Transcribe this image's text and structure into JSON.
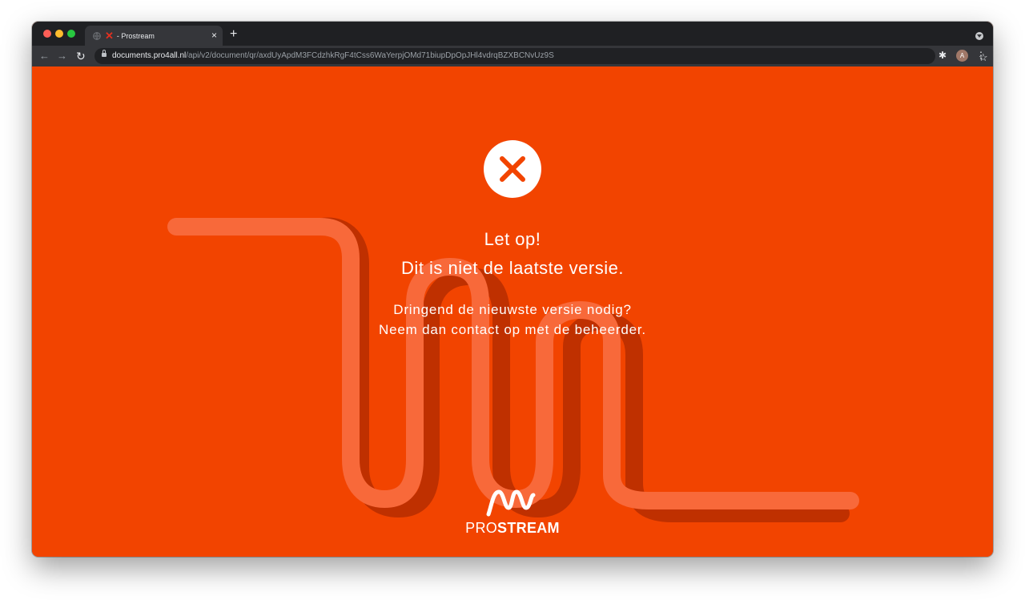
{
  "browser": {
    "tab": {
      "title": "- Prostream",
      "close_glyph": "×",
      "favicon_icon": "red-x-icon"
    },
    "new_tab_glyph": "+",
    "nav": {
      "back_glyph": "←",
      "forward_glyph": "→",
      "reload_glyph": "↻"
    },
    "address_bar": {
      "host": "documents.pro4all.nl",
      "path": "/api/v2/document/qr/axdUyApdM3FCdzhkRgF4tCss6WaYerpjOMd71biupDpOpJHl4vdrqBZXBCNvUz9S"
    },
    "bookmark_glyph": "☆",
    "extensions_glyph": "✱",
    "profile_initial": "A",
    "menu_glyph": "⋮"
  },
  "page": {
    "error_icon": "close-icon",
    "heading_line1": "Let op!",
    "heading_line2": "Dit is niet de laatste versie.",
    "message_line1": "Dringend de nieuwste versie nodig?",
    "message_line2": "Neem dan contact op met de beheerder.",
    "brand": {
      "light": "PRO",
      "bold": "STREAM"
    }
  },
  "colors": {
    "page_background": "#f24400",
    "ribbon": "#f8693a",
    "ribbon_shadow": "#bf3000",
    "text": "#ffffff",
    "browser_frame": "#202124",
    "tab_background": "#35363a"
  }
}
